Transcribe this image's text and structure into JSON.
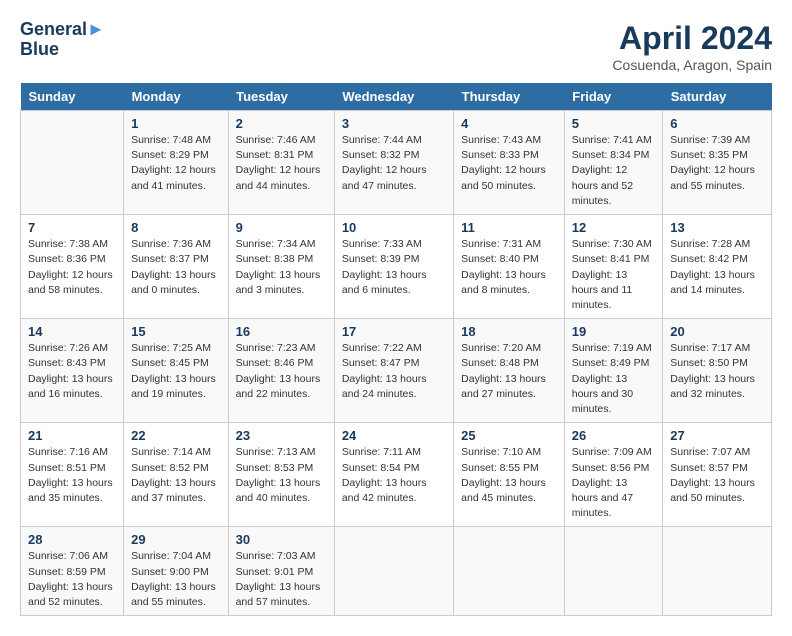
{
  "logo": {
    "line1": "General",
    "line2": "Blue"
  },
  "title": "April 2024",
  "subtitle": "Cosuenda, Aragon, Spain",
  "days_header": [
    "Sunday",
    "Monday",
    "Tuesday",
    "Wednesday",
    "Thursday",
    "Friday",
    "Saturday"
  ],
  "weeks": [
    [
      {
        "num": "",
        "sunrise": "",
        "sunset": "",
        "daylight": ""
      },
      {
        "num": "1",
        "sunrise": "Sunrise: 7:48 AM",
        "sunset": "Sunset: 8:29 PM",
        "daylight": "Daylight: 12 hours and 41 minutes."
      },
      {
        "num": "2",
        "sunrise": "Sunrise: 7:46 AM",
        "sunset": "Sunset: 8:31 PM",
        "daylight": "Daylight: 12 hours and 44 minutes."
      },
      {
        "num": "3",
        "sunrise": "Sunrise: 7:44 AM",
        "sunset": "Sunset: 8:32 PM",
        "daylight": "Daylight: 12 hours and 47 minutes."
      },
      {
        "num": "4",
        "sunrise": "Sunrise: 7:43 AM",
        "sunset": "Sunset: 8:33 PM",
        "daylight": "Daylight: 12 hours and 50 minutes."
      },
      {
        "num": "5",
        "sunrise": "Sunrise: 7:41 AM",
        "sunset": "Sunset: 8:34 PM",
        "daylight": "Daylight: 12 hours and 52 minutes."
      },
      {
        "num": "6",
        "sunrise": "Sunrise: 7:39 AM",
        "sunset": "Sunset: 8:35 PM",
        "daylight": "Daylight: 12 hours and 55 minutes."
      }
    ],
    [
      {
        "num": "7",
        "sunrise": "Sunrise: 7:38 AM",
        "sunset": "Sunset: 8:36 PM",
        "daylight": "Daylight: 12 hours and 58 minutes."
      },
      {
        "num": "8",
        "sunrise": "Sunrise: 7:36 AM",
        "sunset": "Sunset: 8:37 PM",
        "daylight": "Daylight: 13 hours and 0 minutes."
      },
      {
        "num": "9",
        "sunrise": "Sunrise: 7:34 AM",
        "sunset": "Sunset: 8:38 PM",
        "daylight": "Daylight: 13 hours and 3 minutes."
      },
      {
        "num": "10",
        "sunrise": "Sunrise: 7:33 AM",
        "sunset": "Sunset: 8:39 PM",
        "daylight": "Daylight: 13 hours and 6 minutes."
      },
      {
        "num": "11",
        "sunrise": "Sunrise: 7:31 AM",
        "sunset": "Sunset: 8:40 PM",
        "daylight": "Daylight: 13 hours and 8 minutes."
      },
      {
        "num": "12",
        "sunrise": "Sunrise: 7:30 AM",
        "sunset": "Sunset: 8:41 PM",
        "daylight": "Daylight: 13 hours and 11 minutes."
      },
      {
        "num": "13",
        "sunrise": "Sunrise: 7:28 AM",
        "sunset": "Sunset: 8:42 PM",
        "daylight": "Daylight: 13 hours and 14 minutes."
      }
    ],
    [
      {
        "num": "14",
        "sunrise": "Sunrise: 7:26 AM",
        "sunset": "Sunset: 8:43 PM",
        "daylight": "Daylight: 13 hours and 16 minutes."
      },
      {
        "num": "15",
        "sunrise": "Sunrise: 7:25 AM",
        "sunset": "Sunset: 8:45 PM",
        "daylight": "Daylight: 13 hours and 19 minutes."
      },
      {
        "num": "16",
        "sunrise": "Sunrise: 7:23 AM",
        "sunset": "Sunset: 8:46 PM",
        "daylight": "Daylight: 13 hours and 22 minutes."
      },
      {
        "num": "17",
        "sunrise": "Sunrise: 7:22 AM",
        "sunset": "Sunset: 8:47 PM",
        "daylight": "Daylight: 13 hours and 24 minutes."
      },
      {
        "num": "18",
        "sunrise": "Sunrise: 7:20 AM",
        "sunset": "Sunset: 8:48 PM",
        "daylight": "Daylight: 13 hours and 27 minutes."
      },
      {
        "num": "19",
        "sunrise": "Sunrise: 7:19 AM",
        "sunset": "Sunset: 8:49 PM",
        "daylight": "Daylight: 13 hours and 30 minutes."
      },
      {
        "num": "20",
        "sunrise": "Sunrise: 7:17 AM",
        "sunset": "Sunset: 8:50 PM",
        "daylight": "Daylight: 13 hours and 32 minutes."
      }
    ],
    [
      {
        "num": "21",
        "sunrise": "Sunrise: 7:16 AM",
        "sunset": "Sunset: 8:51 PM",
        "daylight": "Daylight: 13 hours and 35 minutes."
      },
      {
        "num": "22",
        "sunrise": "Sunrise: 7:14 AM",
        "sunset": "Sunset: 8:52 PM",
        "daylight": "Daylight: 13 hours and 37 minutes."
      },
      {
        "num": "23",
        "sunrise": "Sunrise: 7:13 AM",
        "sunset": "Sunset: 8:53 PM",
        "daylight": "Daylight: 13 hours and 40 minutes."
      },
      {
        "num": "24",
        "sunrise": "Sunrise: 7:11 AM",
        "sunset": "Sunset: 8:54 PM",
        "daylight": "Daylight: 13 hours and 42 minutes."
      },
      {
        "num": "25",
        "sunrise": "Sunrise: 7:10 AM",
        "sunset": "Sunset: 8:55 PM",
        "daylight": "Daylight: 13 hours and 45 minutes."
      },
      {
        "num": "26",
        "sunrise": "Sunrise: 7:09 AM",
        "sunset": "Sunset: 8:56 PM",
        "daylight": "Daylight: 13 hours and 47 minutes."
      },
      {
        "num": "27",
        "sunrise": "Sunrise: 7:07 AM",
        "sunset": "Sunset: 8:57 PM",
        "daylight": "Daylight: 13 hours and 50 minutes."
      }
    ],
    [
      {
        "num": "28",
        "sunrise": "Sunrise: 7:06 AM",
        "sunset": "Sunset: 8:59 PM",
        "daylight": "Daylight: 13 hours and 52 minutes."
      },
      {
        "num": "29",
        "sunrise": "Sunrise: 7:04 AM",
        "sunset": "Sunset: 9:00 PM",
        "daylight": "Daylight: 13 hours and 55 minutes."
      },
      {
        "num": "30",
        "sunrise": "Sunrise: 7:03 AM",
        "sunset": "Sunset: 9:01 PM",
        "daylight": "Daylight: 13 hours and 57 minutes."
      },
      {
        "num": "",
        "sunrise": "",
        "sunset": "",
        "daylight": ""
      },
      {
        "num": "",
        "sunrise": "",
        "sunset": "",
        "daylight": ""
      },
      {
        "num": "",
        "sunrise": "",
        "sunset": "",
        "daylight": ""
      },
      {
        "num": "",
        "sunrise": "",
        "sunset": "",
        "daylight": ""
      }
    ]
  ]
}
